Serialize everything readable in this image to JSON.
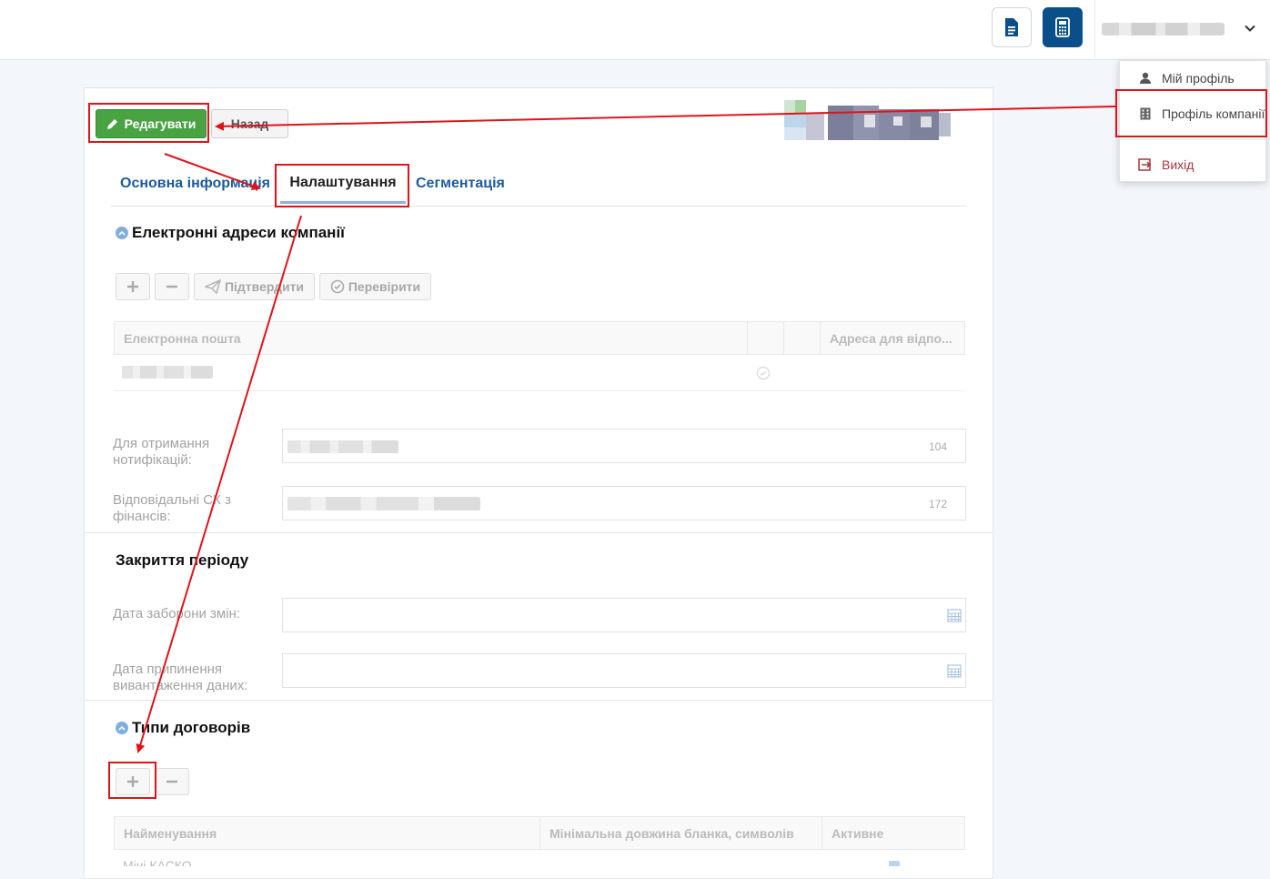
{
  "dropdown": {
    "items": [
      {
        "label": "Мій профіль",
        "icon": "user-icon"
      },
      {
        "label": "Профіль компанії",
        "icon": "building-icon"
      },
      {
        "label": "Вихід",
        "icon": "logout-icon"
      }
    ]
  },
  "toolbar": {
    "edit_label": "Редагувати",
    "back_label": "Назад"
  },
  "tabs": [
    {
      "label": "Основна інформація"
    },
    {
      "label": "Налаштування"
    },
    {
      "label": "Сегментація"
    }
  ],
  "emails": {
    "title": "Електронні адреси компанії",
    "buttons": {
      "confirm": "Підтвердити",
      "check": "Перевірити"
    },
    "columns": [
      "Електронна пошта",
      "",
      "",
      "Адреса для відпо..."
    ]
  },
  "notifications": {
    "label": "Для отримання нотифікацій:",
    "counter": "104"
  },
  "finance": {
    "label": "Відповідальні СК з фінансів:",
    "counter": "172"
  },
  "period": {
    "title": "Закриття періоду",
    "ban_label": "Дата заборони змін:",
    "stop_label": "Дата припинення вивантаження даних:"
  },
  "contracts": {
    "title": "Типи договорів",
    "columns": [
      "Найменування",
      "Мінімальна довжина бланка, символів",
      "Активне"
    ],
    "first_row": "Міні КАСКО"
  },
  "colors": {
    "accent": "#1c5a9c",
    "edit_green": "#4aa343",
    "annotation_red": "#e0131b",
    "exit_red": "#a9343c"
  }
}
